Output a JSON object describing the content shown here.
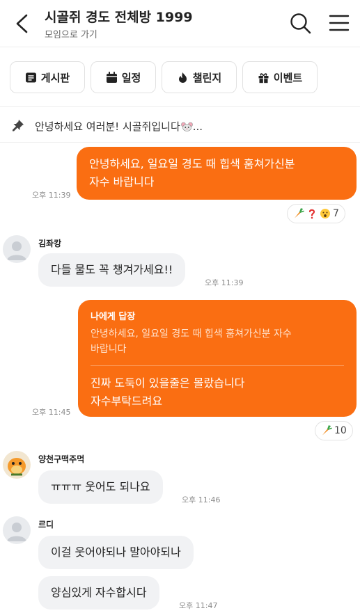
{
  "header": {
    "title": "시골쥐 경도 전체방 1999",
    "subtitle": "모임으로 가기"
  },
  "tabs": [
    {
      "label": "게시판",
      "icon": "board-icon"
    },
    {
      "label": "일정",
      "icon": "calendar-icon"
    },
    {
      "label": "챌린지",
      "icon": "fire-icon"
    },
    {
      "label": "이벤트",
      "icon": "gift-icon"
    }
  ],
  "notice": {
    "text": "안녕하세요 여러분! 시골쥐입니다",
    "suffix": "..."
  },
  "colors": {
    "accent": "#fa6e12",
    "other_bubble": "#f1f2f4"
  },
  "messages": [
    {
      "from": "me",
      "text_line1": "안녕하세요, 일요일 경도 때 힙색 훔쳐가신분",
      "text_line2": "자수 바랍니다",
      "time": "오후 11:39",
      "reactions": {
        "icons": [
          "carrot-icon",
          "question-icon",
          "shocked-face-icon"
        ],
        "count": "7"
      }
    },
    {
      "from": "other",
      "sender": "김좌캉",
      "text": "다들 물도 꼭 챙겨가세요!!",
      "time": "오후 11:39"
    },
    {
      "from": "me",
      "reply_label": "나에게 답장",
      "reply_line1": "안녕하세요, 일요일 경도 때 힙색 훔쳐가신분 자수",
      "reply_line2": "바랍니다",
      "text_line1": "진짜 도둑이 있을줄은 몰랐습니다",
      "text_line2": "자수부탁드려요",
      "time": "오후 11:45",
      "reactions": {
        "icons": [
          "carrot-icon"
        ],
        "count": "10"
      }
    },
    {
      "from": "other",
      "sender": "양천구떡주먹",
      "text": "ㅠㅠㅠ 웃어도 되나요",
      "time": "오후 11:46"
    },
    {
      "from": "other",
      "sender": "르디",
      "text": "이걸 웃어야되나 말아야되나",
      "text2": "양심있게 자수합시다",
      "time": "오후 11:47"
    }
  ]
}
